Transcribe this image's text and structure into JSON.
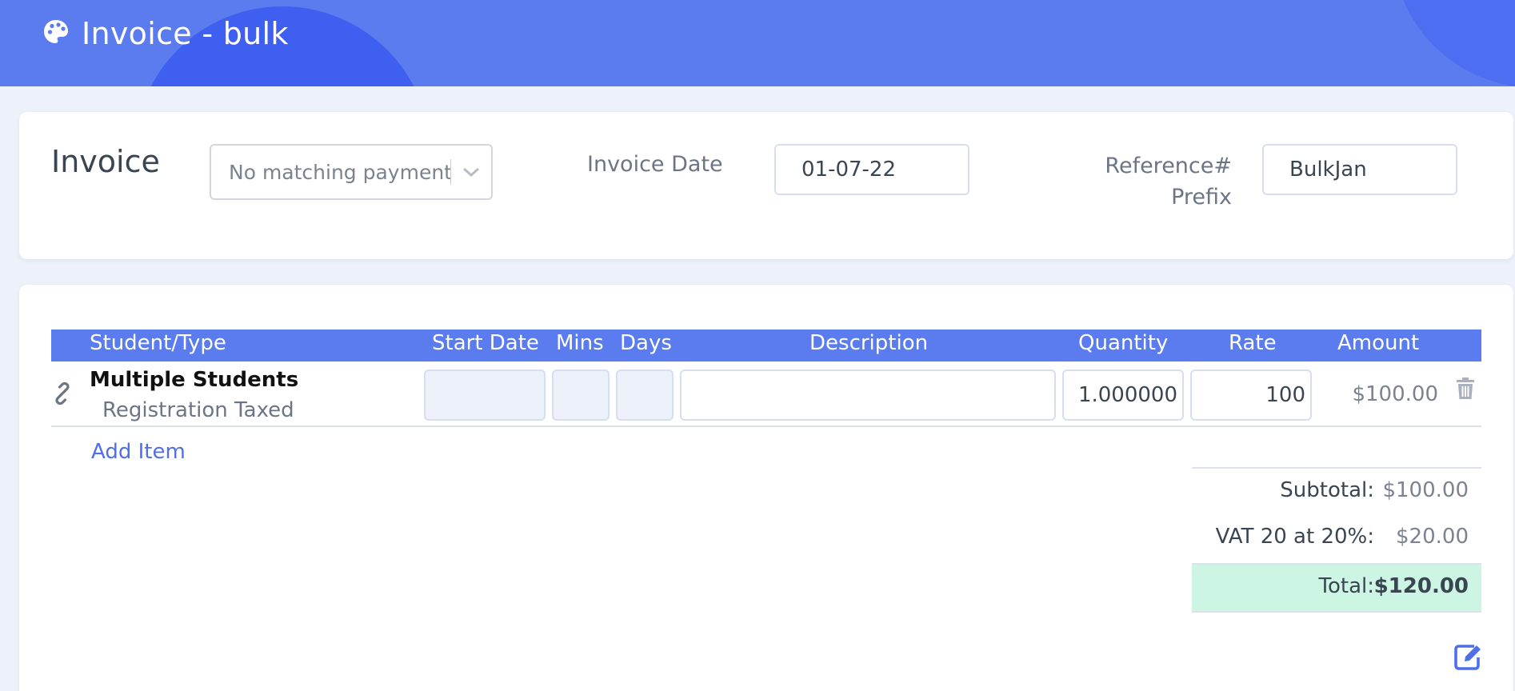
{
  "header": {
    "title": "Invoice - bulk",
    "icon": "palette-icon"
  },
  "invoice_form": {
    "heading": "Invoice",
    "payment_select": {
      "value": "No matching payment"
    },
    "invoice_date": {
      "label": "Invoice Date",
      "value": "01-07-22"
    },
    "reference_prefix": {
      "label_line1": "Reference#",
      "label_line2": "Prefix",
      "value": "BulkJan"
    }
  },
  "items_table": {
    "columns": [
      "Student/Type",
      "Start Date",
      "Mins",
      "Days",
      "Description",
      "Quantity",
      "Rate",
      "Amount"
    ],
    "rows": [
      {
        "student": "Multiple Students",
        "type": "Registration Taxed",
        "start_date": "",
        "mins": "",
        "days": "",
        "description": "",
        "quantity": "1.000000",
        "rate": "100",
        "amount": "$100.00"
      }
    ],
    "add_item_label": "Add Item"
  },
  "totals": {
    "subtotal_label": "Subtotal:",
    "subtotal_value": "$100.00",
    "vat_label": "VAT 20 at 20%:",
    "vat_value": "$20.00",
    "total_label": "Total:",
    "total_value": "$120.00"
  },
  "colors": {
    "header": "#5b7cef",
    "accent": "#4f6fe8",
    "total_bg": "#cdf5e4",
    "page_bg": "#edf1f9"
  }
}
